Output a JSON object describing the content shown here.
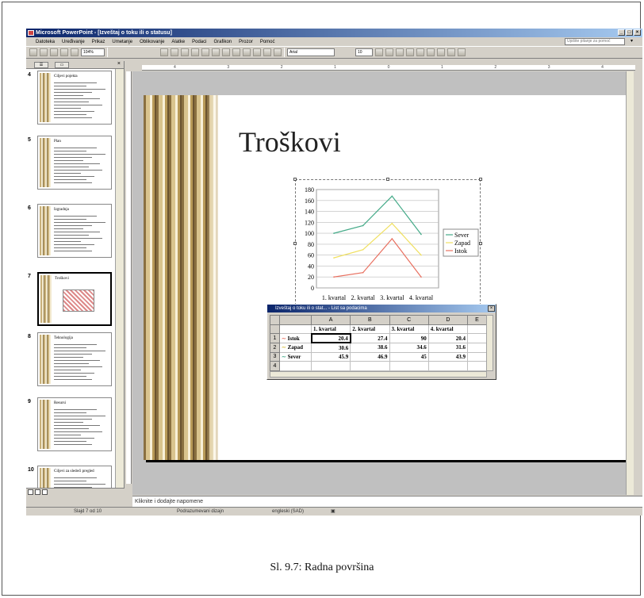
{
  "window": {
    "title": "Microsoft PowerPoint - [Izveštaj o toku ili o statusu]"
  },
  "menu": [
    "Datoteka",
    "Uređivanje",
    "Prikaz",
    "Umetanje",
    "Oblikovanje",
    "Alatke",
    "Podaci",
    "Grafikon",
    "Prozor",
    "Pomoć"
  ],
  "help_box": {
    "placeholder": "Upišite pitanje za pomoć"
  },
  "toolbar": {
    "zoom": "104%",
    "font": "Arial",
    "font_size": "10"
  },
  "ruler": {
    "ticks": [
      "4",
      "3",
      "2",
      "1",
      "0",
      "1",
      "2",
      "3",
      "4"
    ]
  },
  "slides": [
    {
      "num": "4",
      "title": "Ciljevi pojekta"
    },
    {
      "num": "5",
      "title": "Plan"
    },
    {
      "num": "6",
      "title": "Izgradnja"
    },
    {
      "num": "7",
      "title": "Troškovi"
    },
    {
      "num": "8",
      "title": "Tehnologija"
    },
    {
      "num": "9",
      "title": "Resursi"
    },
    {
      "num": "10",
      "title": "Ciljevi za sledeći pregled"
    }
  ],
  "slide": {
    "title": "Troškovi"
  },
  "chart_data": {
    "type": "line",
    "categories": [
      "1. kvartal",
      "2. kvartal",
      "3. kvartal",
      "4. kvartal"
    ],
    "series": [
      {
        "name": "Sever",
        "values": [
          45.9,
          46.9,
          45,
          43.9
        ],
        "color": "#44aa88",
        "display_values": [
          100,
          114,
          168,
          98
        ]
      },
      {
        "name": "Zapad",
        "values": [
          30.6,
          38.6,
          34.6,
          31.6
        ],
        "color": "#f0e060",
        "display_values": [
          55,
          70,
          118,
          60
        ]
      },
      {
        "name": "Istok",
        "values": [
          20.4,
          27.4,
          90,
          20.4
        ],
        "color": "#e87060",
        "display_values": [
          20,
          28,
          90,
          20
        ]
      }
    ],
    "ylim": [
      0,
      180
    ],
    "yticks": [
      "180",
      "160",
      "140",
      "120",
      "100",
      "80",
      "60",
      "40",
      "20",
      "0"
    ],
    "legend": "right"
  },
  "datasheet": {
    "title": "Izveštaj o toku ili o stat... - List sa podacima",
    "col_letters": [
      "A",
      "B",
      "C",
      "D",
      "E"
    ],
    "col_headers": [
      "1. kvartal",
      "2. kvartal",
      "3. kvartal",
      "4. kvartal"
    ],
    "rows": [
      {
        "num": "1",
        "label": "Istok",
        "values": [
          "20.4",
          "27.4",
          "90",
          "20.4"
        ]
      },
      {
        "num": "2",
        "label": "Zapad",
        "values": [
          "30.6",
          "38.6",
          "34.6",
          "31.6"
        ]
      },
      {
        "num": "3",
        "label": "Sever",
        "values": [
          "45.9",
          "46.9",
          "45",
          "43.9"
        ]
      },
      {
        "num": "4",
        "label": "",
        "values": [
          "",
          "",
          "",
          ""
        ]
      }
    ]
  },
  "notes": {
    "placeholder": "Kliknite i dodajte napomene"
  },
  "status": {
    "slide": "Slajd 7 od 10",
    "design": "Podrazumevani dizajn",
    "language": "engleski (SAD)"
  },
  "caption": "Sl. 9.7: Radna površina"
}
